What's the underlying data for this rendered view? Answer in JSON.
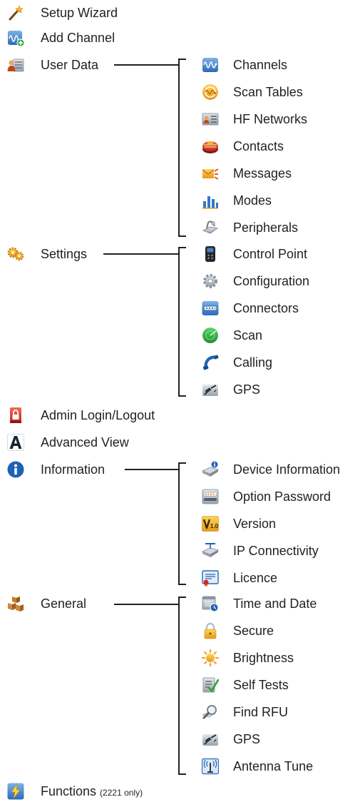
{
  "menu": {
    "setup_wizard": "Setup Wizard",
    "add_channel": "Add Channel",
    "user_data": {
      "label": "User Data",
      "children": [
        "Channels",
        "Scan Tables",
        "HF Networks",
        "Contacts",
        "Messages",
        "Modes",
        "Peripherals"
      ]
    },
    "settings": {
      "label": "Settings",
      "children": [
        "Control Point",
        "Configuration",
        "Connectors",
        "Scan",
        "Calling",
        "GPS"
      ]
    },
    "admin_login": "Admin Login/Logout",
    "advanced_view": "Advanced View",
    "information": {
      "label": "Information",
      "children": [
        "Device Information",
        "Option Password",
        "Version",
        "IP Connectivity",
        "Licence"
      ]
    },
    "general": {
      "label": "General",
      "children": [
        "Time and Date",
        "Secure",
        "Brightness",
        "Self Tests",
        "Find RFU",
        "GPS",
        "Antenna Tune"
      ]
    },
    "functions": "Functions",
    "functions_note": "(2221 only)"
  },
  "icons": {
    "setup_wizard": "magic-wand-icon",
    "add_channel": "add-channel-icon",
    "user_data": "user-data-icon",
    "settings": "settings-gears-icon",
    "admin_login": "admin-lock-icon",
    "advanced_view": "letter-a-icon",
    "information": "info-icon",
    "general": "general-boxes-icon",
    "functions": "lightning-icon"
  },
  "colors": {
    "text": "#231f20",
    "bracket": "#231f20"
  }
}
